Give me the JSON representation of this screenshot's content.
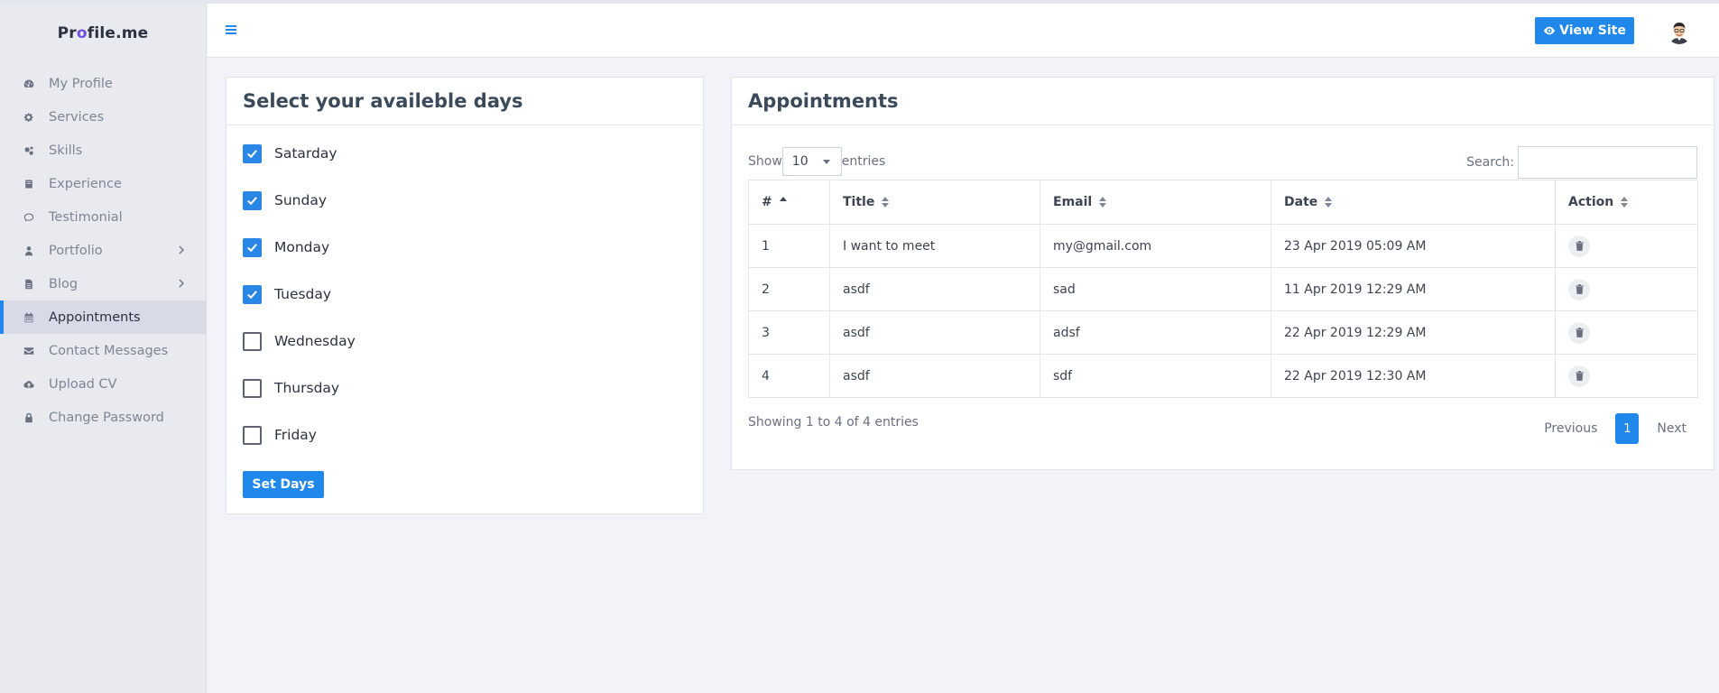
{
  "brand": {
    "prefix": "Pr",
    "o": "o",
    "suffix": "file.me"
  },
  "sidebar": {
    "items": [
      {
        "label": "My Profile",
        "icon": "tachometer-icon"
      },
      {
        "label": "Services",
        "icon": "gear-icon"
      },
      {
        "label": "Skills",
        "icon": "gears-icon"
      },
      {
        "label": "Experience",
        "icon": "book-icon"
      },
      {
        "label": "Testimonial",
        "icon": "comment-icon"
      },
      {
        "label": "Portfolio",
        "icon": "user-icon"
      },
      {
        "label": "Blog",
        "icon": "file-icon"
      },
      {
        "label": "Appointments",
        "icon": "calendar-icon",
        "active": true
      },
      {
        "label": "Contact Messages",
        "icon": "envelope-icon"
      },
      {
        "label": "Upload CV",
        "icon": "cloud-upload-icon"
      },
      {
        "label": "Change Password",
        "icon": "lock-icon"
      }
    ]
  },
  "header": {
    "view_site": "View Site"
  },
  "days_card": {
    "title": "Select your availeble days",
    "days": [
      {
        "label": "Satarday",
        "checked": true
      },
      {
        "label": "Sunday",
        "checked": true
      },
      {
        "label": "Monday",
        "checked": true
      },
      {
        "label": "Tuesday",
        "checked": true
      },
      {
        "label": "Wednesday",
        "checked": false
      },
      {
        "label": "Thursday",
        "checked": false
      },
      {
        "label": "Friday",
        "checked": false
      }
    ],
    "button": "Set Days"
  },
  "appointments": {
    "title": "Appointments",
    "show_label": "Show",
    "entries_label": "entries",
    "page_size": "10",
    "search_label": "Search:",
    "columns": [
      "#",
      "Title",
      "Email",
      "Date",
      "Action"
    ],
    "rows": [
      {
        "num": "1",
        "title": "I want to meet",
        "email": "my@gmail.com",
        "date": "23 Apr 2019 05:09 AM"
      },
      {
        "num": "2",
        "title": "asdf",
        "email": "sad",
        "date": "11 Apr 2019 12:29 AM"
      },
      {
        "num": "3",
        "title": "asdf",
        "email": "adsf",
        "date": "22 Apr 2019 12:29 AM"
      },
      {
        "num": "4",
        "title": "asdf",
        "email": "sdf",
        "date": "22 Apr 2019 12:30 AM"
      }
    ],
    "info": "Showing 1 to 4 of 4 entries",
    "pager": {
      "previous": "Previous",
      "page": "1",
      "next": "Next"
    }
  },
  "colors": {
    "accent": "#2088ea",
    "brand_o": "#6c4de0"
  }
}
